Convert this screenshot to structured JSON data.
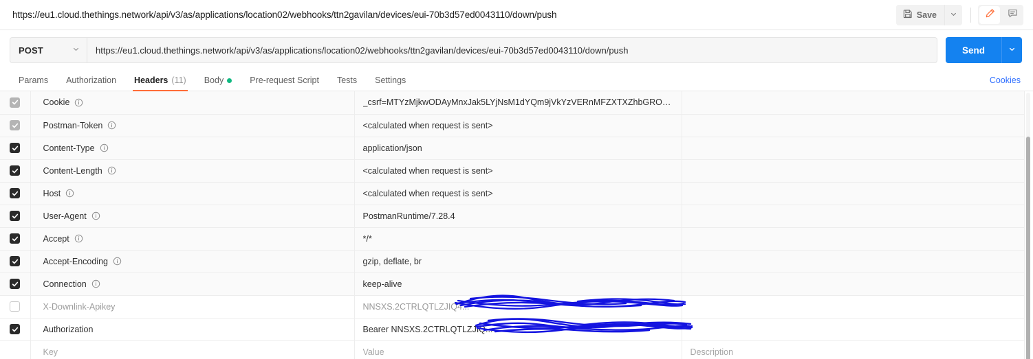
{
  "titlebar": {
    "request_url": "https://eu1.cloud.thethings.network/api/v3/as/applications/location02/webhooks/ttn2gavilan/devices/eui-70b3d57ed0043110/down/push",
    "save_label": "Save"
  },
  "urlbar": {
    "method": "POST",
    "url": "https://eu1.cloud.thethings.network/api/v3/as/applications/location02/webhooks/ttn2gavilan/devices/eui-70b3d57ed0043110/down/push",
    "send_label": "Send"
  },
  "tabs": [
    {
      "label": "Params",
      "active": false,
      "count": "",
      "dot": false
    },
    {
      "label": "Authorization",
      "active": false,
      "count": "",
      "dot": false
    },
    {
      "label": "Headers",
      "active": true,
      "count": "(11)",
      "dot": false
    },
    {
      "label": "Body",
      "active": false,
      "count": "",
      "dot": true
    },
    {
      "label": "Pre-request Script",
      "active": false,
      "count": "",
      "dot": false
    },
    {
      "label": "Tests",
      "active": false,
      "count": "",
      "dot": false
    },
    {
      "label": "Settings",
      "active": false,
      "count": "",
      "dot": false
    }
  ],
  "cookies_link": "Cookies",
  "table": {
    "columns": [
      "Key",
      "Value",
      "Description"
    ],
    "placeholders": {
      "key": "Key",
      "value": "Value",
      "description": "Description"
    },
    "rows": [
      {
        "checkbox": "locked",
        "key": "Cookie",
        "info": true,
        "value": "_csrf=MTYzMjkwODAyMnxJak5LYjNsM1dYQm9jVkYzVERnMFZXTXZhbGROVn...",
        "description": "",
        "muted_key": false,
        "muted_value": false,
        "shaded": true,
        "redacted": false
      },
      {
        "checkbox": "locked",
        "key": "Postman-Token",
        "info": true,
        "value": "<calculated when request is sent>",
        "description": "",
        "muted_key": false,
        "muted_value": false,
        "shaded": true,
        "redacted": false
      },
      {
        "checkbox": "checked",
        "key": "Content-Type",
        "info": true,
        "value": "application/json",
        "description": "",
        "muted_key": false,
        "muted_value": false,
        "shaded": true,
        "redacted": false
      },
      {
        "checkbox": "checked",
        "key": "Content-Length",
        "info": true,
        "value": "<calculated when request is sent>",
        "description": "",
        "muted_key": false,
        "muted_value": false,
        "shaded": true,
        "redacted": false
      },
      {
        "checkbox": "checked",
        "key": "Host",
        "info": true,
        "value": "<calculated when request is sent>",
        "description": "",
        "muted_key": false,
        "muted_value": false,
        "shaded": true,
        "redacted": false
      },
      {
        "checkbox": "checked",
        "key": "User-Agent",
        "info": true,
        "value": "PostmanRuntime/7.28.4",
        "description": "",
        "muted_key": false,
        "muted_value": false,
        "shaded": true,
        "redacted": false
      },
      {
        "checkbox": "checked",
        "key": "Accept",
        "info": true,
        "value": "*/*",
        "description": "",
        "muted_key": false,
        "muted_value": false,
        "shaded": true,
        "redacted": false
      },
      {
        "checkbox": "checked",
        "key": "Accept-Encoding",
        "info": true,
        "value": "gzip, deflate, br",
        "description": "",
        "muted_key": false,
        "muted_value": false,
        "shaded": true,
        "redacted": false
      },
      {
        "checkbox": "checked",
        "key": "Connection",
        "info": true,
        "value": "keep-alive",
        "description": "",
        "muted_key": false,
        "muted_value": false,
        "shaded": true,
        "redacted": false
      },
      {
        "checkbox": "empty",
        "key": "X-Downlink-Apikey",
        "info": false,
        "value": "NNSXS.2CTRLQTLZJIQ4...",
        "description": "",
        "muted_key": true,
        "muted_value": true,
        "shaded": false,
        "redacted": true
      },
      {
        "checkbox": "checked",
        "key": "Authorization",
        "info": false,
        "value": "Bearer NNSXS.2CTRLQTLZJIQ...",
        "description": "",
        "muted_key": false,
        "muted_value": false,
        "shaded": false,
        "redacted": true
      },
      {
        "checkbox": "none",
        "key": "Key",
        "info": false,
        "value": "Value",
        "description": "Description",
        "muted_key": true,
        "muted_value": true,
        "shaded": false,
        "redacted": false,
        "is_placeholder": true
      }
    ]
  },
  "colors": {
    "accent_orange": "#ff6c37",
    "send_blue": "#1482f0",
    "link_blue": "#2f6fff",
    "body_dot_green": "#10b981",
    "redaction_blue": "#1414e0"
  }
}
